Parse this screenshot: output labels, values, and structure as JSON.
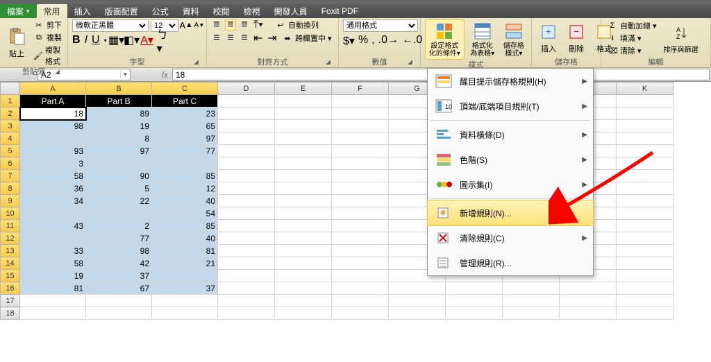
{
  "tabs": {
    "file": "檔案",
    "list": [
      "常用",
      "插入",
      "版面配置",
      "公式",
      "資料",
      "校閱",
      "檢視",
      "開發人員",
      "Foxit PDF"
    ],
    "active": 0
  },
  "ribbon": {
    "clipboard": {
      "paste": "貼上",
      "cut": "剪下",
      "copy": "複製",
      "format_painter": "複製格式",
      "group": "剪貼簿"
    },
    "font": {
      "name": "微軟正黑體",
      "size": "12",
      "group": "字型"
    },
    "alignment": {
      "wrap": "自動換列",
      "merge": "跨欄置中",
      "group": "對齊方式"
    },
    "number": {
      "format": "通用格式",
      "group": "數值"
    },
    "styles": {
      "cond_fmt": "設定格式化的條件",
      "as_table": "格式化為表格",
      "cell_styles": "儲存格樣式",
      "group": "樣式"
    },
    "cells": {
      "insert": "插入",
      "delete": "刪除",
      "format": "格式",
      "group": "儲存格"
    },
    "editing": {
      "autosum": "自動加總",
      "fill": "填滿",
      "clear": "清除",
      "sort": "排序與篩選",
      "group": "編輯"
    }
  },
  "namebox": "A2",
  "formula": "18",
  "columns": [
    "A",
    "B",
    "C",
    "D",
    "E",
    "F",
    "G",
    "H",
    "I",
    "J",
    "K"
  ],
  "headers": [
    "Part A",
    "Part B",
    "Part C"
  ],
  "chart_data": {
    "type": "table",
    "columns": [
      "Part A",
      "Part B",
      "Part C"
    ],
    "rows": [
      [
        18,
        89,
        23
      ],
      [
        98,
        19,
        65
      ],
      [
        null,
        8,
        97
      ],
      [
        93,
        97,
        77
      ],
      [
        3,
        null,
        null
      ],
      [
        58,
        90,
        85
      ],
      [
        36,
        5,
        12
      ],
      [
        34,
        22,
        40
      ],
      [
        null,
        null,
        54
      ],
      [
        43,
        2,
        85
      ],
      [
        null,
        77,
        40
      ],
      [
        33,
        98,
        81
      ],
      [
        58,
        42,
        21
      ],
      [
        19,
        37,
        null
      ],
      [
        81,
        67,
        37
      ]
    ]
  },
  "cf_menu": {
    "highlight": "醒目提示儲存格規則(H)",
    "top_bottom": "頂端/底端項目規則(T)",
    "data_bars": "資料橫條(D)",
    "color_scales": "色階(S)",
    "icon_sets": "圖示集(I)",
    "new_rule": "新增規則(N)...",
    "clear_rules": "清除規則(C)",
    "manage_rules": "管理規則(R)..."
  }
}
